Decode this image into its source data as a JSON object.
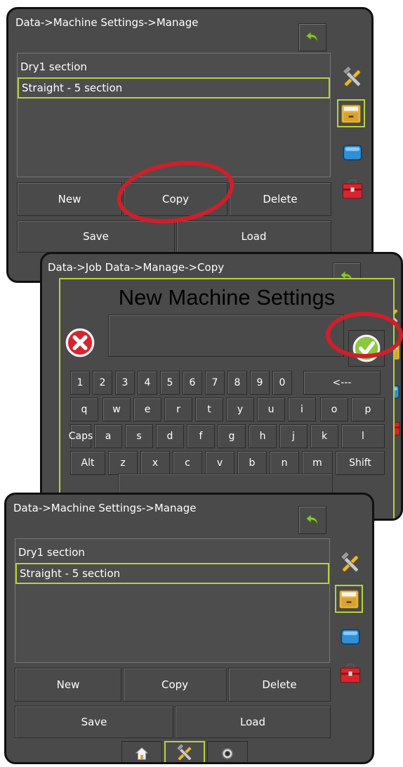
{
  "screen_top": {
    "breadcrumb": "Data->Machine Settings->Manage",
    "list": [
      "Dry1 section",
      "Straight - 5 section"
    ],
    "buttons": {
      "new": "New",
      "copy": "Copy",
      "delete": "Delete",
      "save": "Save",
      "load": "Load"
    }
  },
  "screen_mid": {
    "breadcrumb": "Data->Job Data->Manage->Copy",
    "dialog_title": "New Machine Settings",
    "name_input_value": "",
    "keyboard_rows": [
      [
        "1",
        "2",
        "3",
        "4",
        "5",
        "6",
        "7",
        "8",
        "9",
        "0",
        "<---"
      ],
      [
        "q",
        "w",
        "e",
        "r",
        "t",
        "y",
        "u",
        "i",
        "o",
        "p"
      ],
      [
        "Caps",
        "a",
        "s",
        "d",
        "f",
        "g",
        "h",
        "j",
        "k",
        "l"
      ],
      [
        "Alt",
        "z",
        "x",
        "c",
        "v",
        "b",
        "n",
        "m",
        "Shift"
      ]
    ]
  },
  "screen_bottom": {
    "breadcrumb": "Data->Machine Settings->Manage",
    "list": [
      "Dry1 section",
      "Straight - 5 section"
    ],
    "buttons": {
      "new": "New",
      "copy": "Copy",
      "delete": "Delete",
      "save": "Save",
      "load": "Load"
    }
  },
  "icons": {
    "back": "back-arrow-icon",
    "tools": "tools-icon",
    "storage": "storage-drawer-icon",
    "display": "display-screen-icon",
    "toolbox": "toolbox-icon",
    "cancel": "cancel-x-icon",
    "accept": "accept-check-icon",
    "home": "home-icon",
    "gps": "gps-target-icon"
  },
  "colors": {
    "accent": "#b5d33a",
    "highlight": "#d11e2a",
    "panel": "#4a4a4a"
  }
}
